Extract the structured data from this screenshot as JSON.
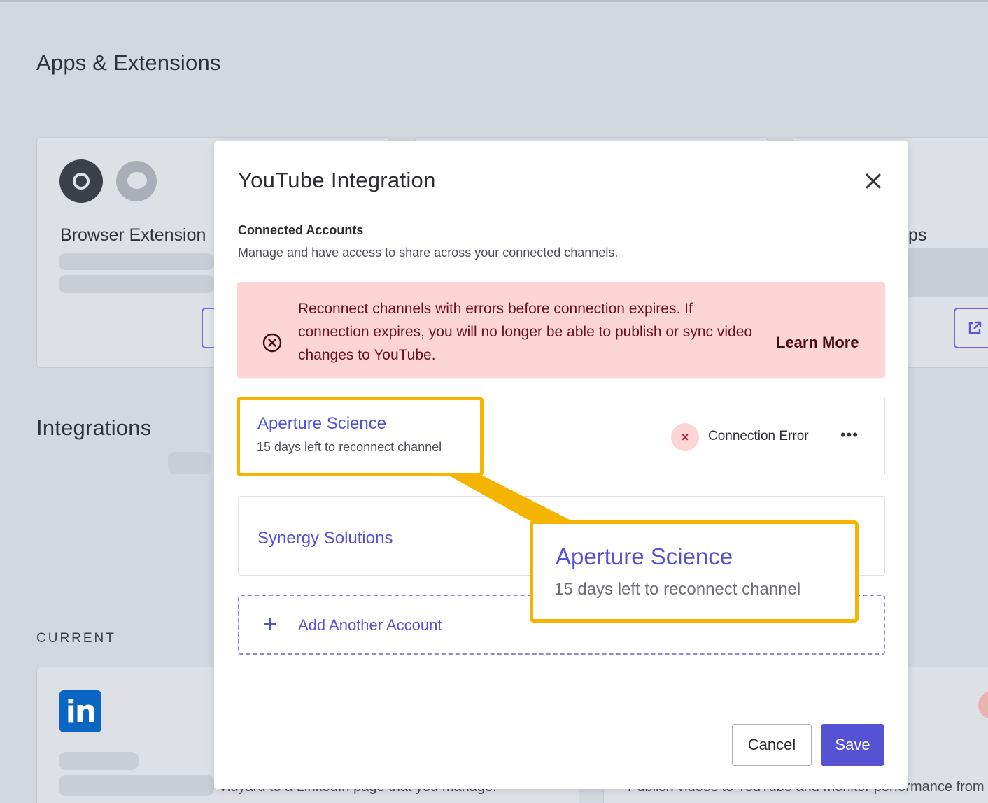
{
  "background": {
    "apps_heading": "Apps & Extensions",
    "integrations_heading": "Integrations",
    "current_label": "CURRENT",
    "browser_extension_title": "Browser Extension",
    "right_card_title_fragment": "ps",
    "linkedin_desc_fragment": "Vidyard to a LinkedIn page that you manage.",
    "youtube_desc_fragment": "Publish videos to YouTube and monitor performance from",
    "linkedin_icon_text": "in"
  },
  "modal": {
    "title": "YouTube Integration",
    "close_icon": "close-icon",
    "section_title": "Connected Accounts",
    "section_desc": "Manage and have access to share across your connected channels.",
    "alert": {
      "text": "Reconnect channels with errors before connection expires. If connection expires, you will no longer be able to publish or sync video changes to YouTube.",
      "link": "Learn More",
      "color": "#fdd5d5"
    },
    "accounts": [
      {
        "name": "Aperture Science",
        "subtitle": "15 days left to reconnect channel",
        "status": "Connection Error",
        "status_badge": "×",
        "menu": "•••"
      },
      {
        "name": "Synergy Solutions"
      }
    ],
    "add_account": {
      "icon": "+",
      "label": "Add Another Account"
    },
    "buttons": {
      "cancel": "Cancel",
      "save": "Save"
    }
  },
  "callout": {
    "name": "Aperture Science",
    "subtitle": "15 days left to reconnect channel",
    "color": "#f4b400"
  },
  "colors": {
    "accent": "#5652d4",
    "error_text": "#6b0f1c"
  }
}
